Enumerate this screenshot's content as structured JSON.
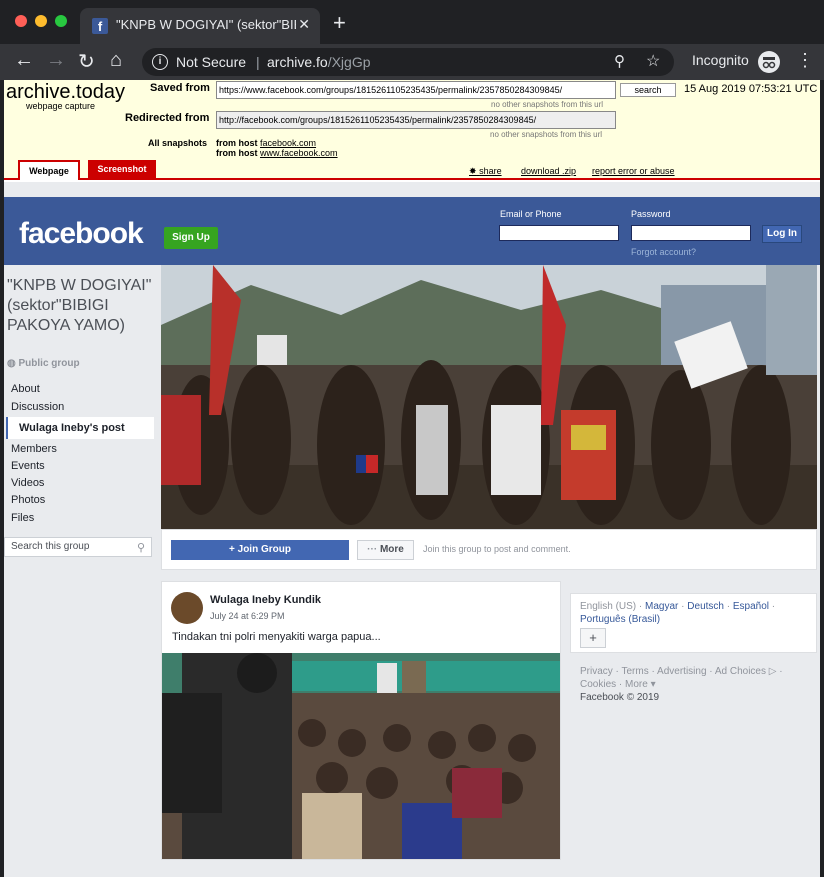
{
  "browser": {
    "tab_title": "\"KNPB W DOGIYAI\" (sektor\"BIBI",
    "security_label": "Not Secure",
    "url_host": "archive.fo",
    "url_path": "/XjgGp",
    "profile_label": "Incognito"
  },
  "archive": {
    "logo": "archive.today",
    "subtitle": "webpage capture",
    "saved_from_label": "Saved from",
    "saved_from_url": "https://www.facebook.com/groups/1815261105235435/permalink/2357850284309845/",
    "search_label": "search",
    "capture_date": "15 Aug 2019 07:53:21 UTC",
    "note": "no other snapshots from this url",
    "redirected_label": "Redirected from",
    "redirected_url": "http://facebook.com/groups/1815261105235435/permalink/2357850284309845/",
    "all_snapshots_label": "All snapshots",
    "host_prefix": "from host",
    "host1": "facebook.com",
    "host2": "www.facebook.com",
    "tab_webpage": "Webpage",
    "tab_screenshot": "Screenshot",
    "share_label": "share",
    "download_label": "download .zip",
    "report_label": "report error or abuse"
  },
  "fb": {
    "logo": "facebook",
    "signup": "Sign Up",
    "email_label": "Email or Phone",
    "password_label": "Password",
    "login": "Log In",
    "forgot": "Forgot account?"
  },
  "group": {
    "name": "\"KNPB W DOGIYAI\" (sektor\"BIBIGI PAKOYA YAMO)",
    "privacy": "Public group",
    "nav": [
      "About",
      "Discussion",
      "Wulaga Ineby's post",
      "Members",
      "Events",
      "Videos",
      "Photos",
      "Files"
    ],
    "search_placeholder": "Search this group",
    "join": "Join Group",
    "more": "More",
    "join_hint": "Join this group to post and comment."
  },
  "post": {
    "author": "Wulaga Ineby Kundik",
    "time": "July 24 at 6:29 PM",
    "text": "Tindakan tni polri menyakiti warga papua..."
  },
  "languages": {
    "current": "English (US)",
    "others": [
      "Magyar",
      "Deutsch",
      "Español",
      "Português (Brasil)"
    ]
  },
  "footer": {
    "links": "Privacy · Terms · Advertising · Ad Choices ▷ · Cookies · More ▾",
    "copyright": "Facebook © 2019"
  },
  "colors": {
    "fb_blue": "#3b5998",
    "signup_green": "#36a420",
    "archive_bg": "#ffffe0",
    "archive_red": "#cc0000"
  }
}
